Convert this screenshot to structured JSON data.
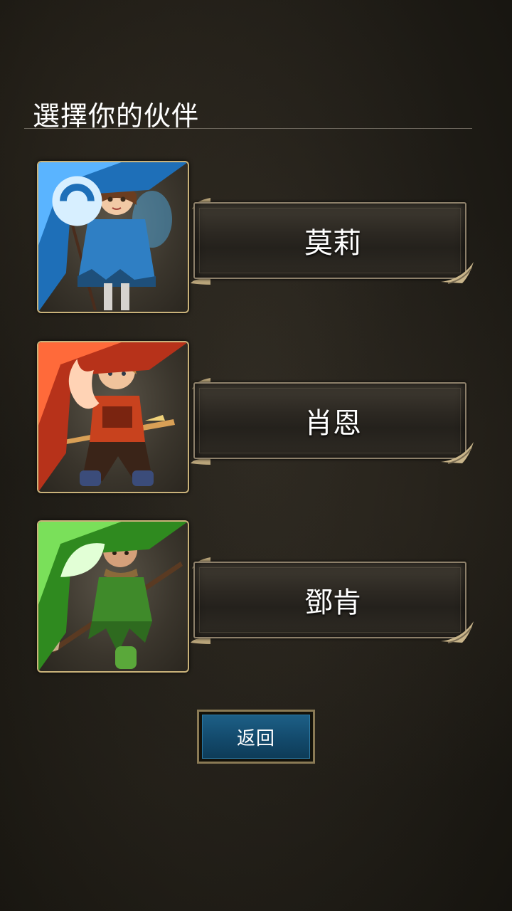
{
  "screen": {
    "title": "選擇你的伙伴"
  },
  "companions": [
    {
      "name": "莫莉",
      "element": "water",
      "element_icon": "water-element-icon",
      "element_color": "#2f8fd9",
      "portrait_icon": "mage-girl-portrait"
    },
    {
      "name": "肖恩",
      "element": "fire",
      "element_icon": "fire-element-icon",
      "element_color": "#e0461e",
      "portrait_icon": "swordsman-portrait"
    },
    {
      "name": "鄧肯",
      "element": "wood",
      "element_icon": "wood-element-icon",
      "element_color": "#49b52f",
      "portrait_icon": "spearman-portrait"
    }
  ],
  "back_button": {
    "label": "返回",
    "color": "#1b5a80"
  }
}
